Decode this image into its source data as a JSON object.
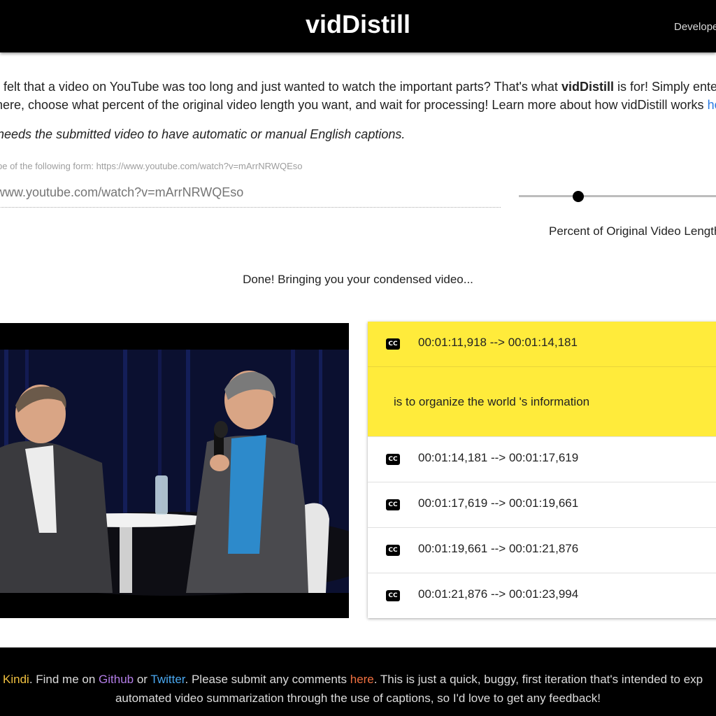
{
  "header": {
    "brand": "vidDistill",
    "nav_link": "Developer"
  },
  "intro": {
    "line1_a": "r felt that a video on YouTube was too long and just wanted to watch the important parts? That's what ",
    "line1_bold": "vidDistill",
    "line1_b": " is for! Simply enter a",
    "line2_a": "here, choose what percent of the original video length you want, and wait for processing! Learn more about how vidDistill works ",
    "line2_link": "here"
  },
  "note": "needs the submitted video to have automatic or manual English captions.",
  "url_field": {
    "hint": "be of the following form: https://www.youtube.com/watch?v=mArrNRWQEso",
    "placeholder": "www.youtube.com/watch?v=mArrNRWQEso"
  },
  "slider": {
    "label": "Percent of Original Video Length",
    "value_fraction": 0.3
  },
  "status": "Done! Bringing you your condensed video...",
  "captions": [
    {
      "time": "00:01:11,918 --> 00:01:14,181",
      "text": "is to organize the world 's information",
      "active": true,
      "icon": "cc-icon"
    },
    {
      "time": "00:01:14,181 --> 00:01:17,619",
      "active": false,
      "icon": "cc-icon"
    },
    {
      "time": "00:01:17,619 --> 00:01:19,661",
      "active": false,
      "icon": "cc-icon"
    },
    {
      "time": "00:01:19,661 --> 00:01:21,876",
      "active": false,
      "icon": "cc-icon"
    },
    {
      "time": "00:01:21,876 --> 00:01:23,994",
      "active": false,
      "icon": "cc-icon"
    }
  ],
  "cc_glyph": "CC",
  "footer": {
    "kindi": "Kindi",
    "text1": ". Find me on ",
    "github": "Github",
    "or": " or ",
    "twitter": "Twitter",
    "text2": ". Please submit any comments ",
    "here": "here",
    "text3": ". This is just a quick, buggy, first iteration that's intended to exp",
    "line2": "automated video summarization through the use of captions, so I'd love to get any feedback!"
  },
  "colors": {
    "caption_highlight": "#ffeb3b",
    "link_blue": "#2a7ae2",
    "header_bg": "#000000"
  }
}
